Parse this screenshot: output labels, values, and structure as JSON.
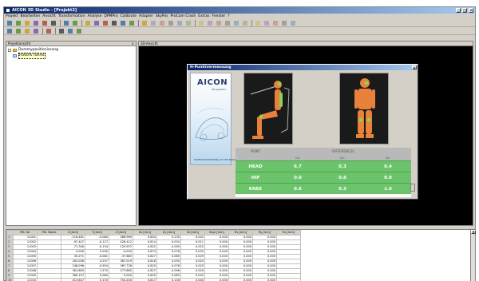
{
  "window": {
    "title": "AICON 3D Studio - [Projekt2]"
  },
  "menu": [
    "Projekt",
    "Bearbeiten",
    "Ansicht",
    "Transformation",
    "Analyse",
    "DPMPro",
    "Calibrate",
    "Adapter",
    "SkyPos",
    "ProCam Crash",
    "Extras",
    "Fenster",
    "?"
  ],
  "toolbar1_icons": [
    "new-icon",
    "open-icon",
    "save-icon",
    "print-icon",
    "cut-icon",
    "delete-icon",
    "frame-icon",
    "brush-icon",
    "view1-icon",
    "view2-icon",
    "view3-icon",
    "view4-icon",
    "view5-icon",
    "view6-icon",
    "tool1-icon",
    "tool2-icon",
    "tool3-icon",
    "tool4-icon",
    "tool5-icon",
    "tool6-icon",
    "tool7-icon",
    "tool8-icon",
    "tool9-icon",
    "tool10-icon",
    "tool11-icon",
    "tool12-icon",
    "tool13-icon",
    "tool14-icon",
    "tool15-icon",
    "tool16-icon",
    "tool17-icon"
  ],
  "toolbar2_icons": [
    "run-icon",
    "points-icon",
    "network-icon",
    "grid-icon",
    "monitor-icon",
    "play-icon",
    "pause-icon",
    "settings-icon"
  ],
  "left_pane": {
    "title": "Projektansicht",
    "close": "×",
    "tree": [
      {
        "label": "Dummypositionierung",
        "selected": false
      },
      {
        "label": "H500% Fahrer",
        "selected": true
      }
    ]
  },
  "right_pane": {
    "title": "3D-Ansicht"
  },
  "dialog": {
    "title": "H-Punktvermessung",
    "close": "×",
    "logo_text": "AICON",
    "logo_sub": "3D Systems",
    "logo_footer": "DUMMYPOSITIONING AT THE BROWSER",
    "results": {
      "headers": [
        "POINT",
        "DIFFERENCES"
      ],
      "subheaders": [
        "Dx:",
        "Dy:",
        "Dz:"
      ],
      "rows": [
        {
          "point": "HEAD",
          "dx": "6.7",
          "dy": "0.3",
          "dz": "0.4"
        },
        {
          "point": "HIP",
          "dx": "0.0",
          "dy": "0.8",
          "dz": "0.9"
        },
        {
          "point": "KNEE",
          "dx": "0.6",
          "dy": "0.3",
          "dz": "1.0"
        }
      ]
    }
  },
  "grid": {
    "columns": [
      "",
      "Pkt. Nr.",
      "Pkt. Name",
      "X [mm]",
      "Y [mm]",
      "Z [mm]",
      "Sx [mm]",
      "Sy [mm]",
      "Sz [mm]",
      "Sxyz [mm]",
      "Rx [mm]",
      "Ry [mm]",
      "Rz [mm]"
    ],
    "rows": [
      [
        "1",
        "11001",
        "",
        "-116.461",
        "-0.080",
        "368.969",
        "0.854",
        "0.130",
        "0.042",
        "0.000",
        "0.000",
        "0.000"
      ],
      [
        "2",
        "11002",
        "",
        "-97.447",
        "-0.127",
        "428.412",
        "0.814",
        "0.034",
        "0.011",
        "0.000",
        "0.000",
        "0.000"
      ],
      [
        "3",
        "11003",
        "",
        "-71.346",
        "-0.134",
        "129.937",
        "0.822",
        "0.095",
        "0.022",
        "0.000",
        "0.000",
        "0.000"
      ],
      [
        "4",
        "11004",
        "",
        "0.000",
        "0.000",
        "-0.000",
        "0.874",
        "0.078",
        "0.032",
        "0.000",
        "0.000",
        "0.000"
      ],
      [
        "5",
        "11005",
        "",
        "35.271",
        "-0.081",
        "-37.683",
        "0.827",
        "0.085",
        "0.029",
        "0.000",
        "0.000",
        "0.000"
      ],
      [
        "6",
        "11006",
        "",
        "182.058",
        "0.257",
        "387.019",
        "0.816",
        "0.030",
        "0.025",
        "0.000",
        "0.000",
        "0.000"
      ],
      [
        "7",
        "11007",
        "",
        "248.096",
        "-0.954",
        "367.726",
        "0.825",
        "0.076",
        "0.025",
        "0.000",
        "0.000",
        "0.000"
      ],
      [
        "8",
        "11008",
        "",
        "381.883",
        "1.570",
        "277.865",
        "0.827",
        "0.096",
        "0.029",
        "0.000",
        "0.000",
        "0.000"
      ],
      [
        "9",
        "11009",
        "",
        "360.157",
        "0.080",
        "0.000",
        "0.825",
        "0.083",
        "0.032",
        "0.000",
        "0.000",
        "0.000"
      ],
      [
        "10",
        "11010",
        "",
        "413.647",
        "0.133",
        "754.200",
        "0.817",
        "0.118",
        "0.040",
        "0.000",
        "0.000",
        "0.000"
      ]
    ]
  },
  "colors": {
    "title_gradient_start": "#0a246a",
    "title_gradient_end": "#a6caf0",
    "result_green": "#6bc46b",
    "figure_orange": "#e8823a",
    "figure_green": "#8ed15a",
    "canvas_bg": "#000000"
  }
}
